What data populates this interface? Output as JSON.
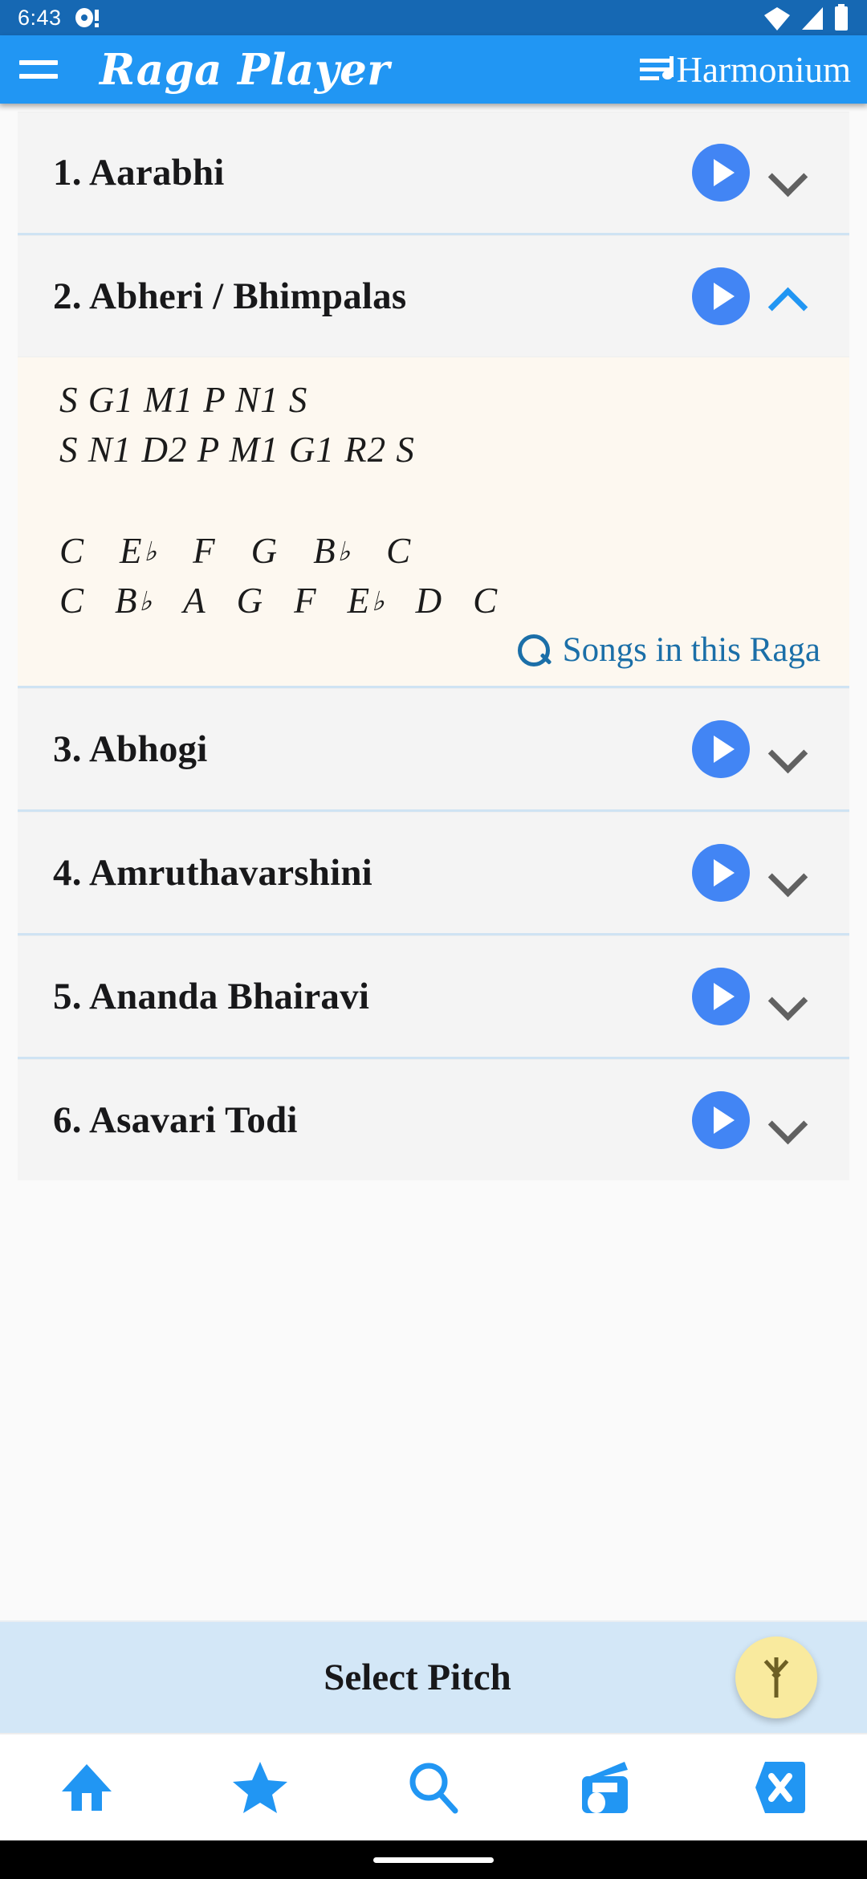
{
  "status_bar": {
    "time": "6:43",
    "icons": [
      "notification-dot-icon",
      "wifi-icon",
      "signal-icon",
      "battery-icon"
    ]
  },
  "app_bar": {
    "menu_icon": "hamburger-menu-icon",
    "title": "Raga Player",
    "instrument_icon": "playlist-queue-music-icon",
    "instrument": "Harmonium"
  },
  "list": {
    "items": [
      {
        "label": "1. Aarabhi",
        "expanded": false
      },
      {
        "label": "2. Abheri / Bhimpalas",
        "expanded": true
      },
      {
        "label": "3. Abhogi",
        "expanded": false
      },
      {
        "label": "4. Amruthavarshini",
        "expanded": false
      },
      {
        "label": "5. Ananda Bhairavi",
        "expanded": false
      },
      {
        "label": "6. Asavari Todi",
        "expanded": false
      }
    ]
  },
  "expanded_detail": {
    "arohana_swaras": "S  G1  M1  P  N1  S",
    "avarohana_swaras": "S  N1  D2  P  M1  G1  R2  S",
    "arohana_western": [
      {
        "note": "C",
        "flat": ""
      },
      {
        "note": "E",
        "flat": "♭"
      },
      {
        "note": "F",
        "flat": ""
      },
      {
        "note": "G",
        "flat": ""
      },
      {
        "note": "B",
        "flat": "♭"
      },
      {
        "note": "C",
        "flat": ""
      }
    ],
    "avarohana_western": [
      {
        "note": "C",
        "flat": ""
      },
      {
        "note": "B",
        "flat": "♭"
      },
      {
        "note": "A",
        "flat": ""
      },
      {
        "note": "G",
        "flat": ""
      },
      {
        "note": "F",
        "flat": ""
      },
      {
        "note": "E",
        "flat": "♭"
      },
      {
        "note": "D",
        "flat": ""
      },
      {
        "note": "C",
        "flat": ""
      }
    ],
    "songs_link": "Songs in this Raga",
    "songs_link_icon": "search-icon"
  },
  "pitch_bar": {
    "label": "Select Pitch",
    "fab_icon": "arrow-up-icon"
  },
  "bottom_nav": {
    "items": [
      {
        "icon": "home-icon"
      },
      {
        "icon": "star-icon"
      },
      {
        "icon": "search-icon"
      },
      {
        "icon": "radio-icon"
      },
      {
        "icon": "close-x-icon"
      }
    ]
  },
  "colors": {
    "status_bar": "#1668b3",
    "app_bar": "#2196f3",
    "accent_blue": "#4285f4",
    "link_blue": "#1b6fa8",
    "panel_cream": "#fdf8f0",
    "pitch_bar": "#d3e7f7",
    "fab_yellow": "#f9ea9e"
  }
}
